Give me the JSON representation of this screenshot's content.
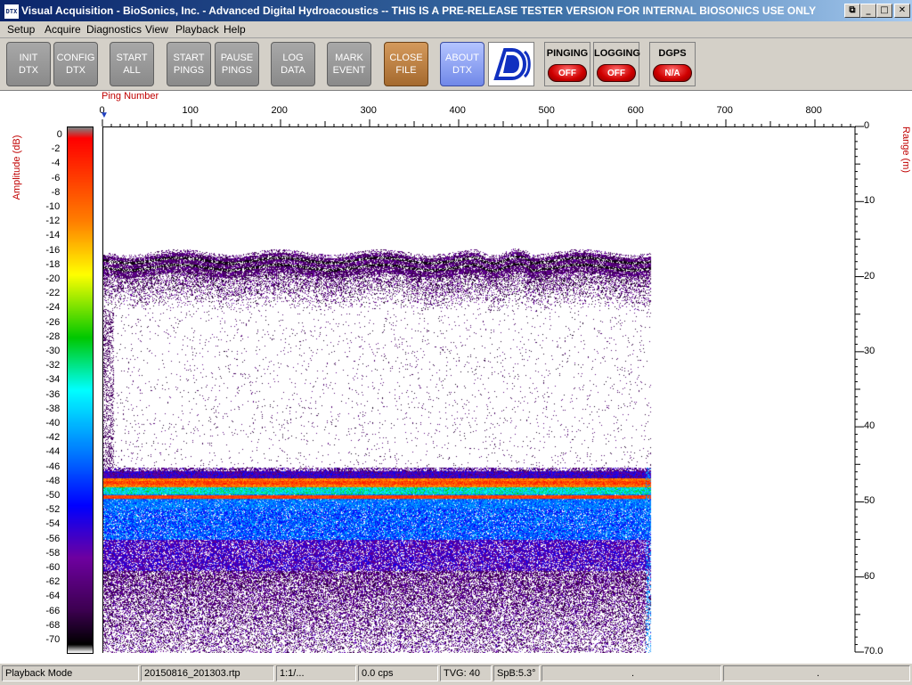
{
  "window": {
    "icon_text": "DTX",
    "title": "Visual Acquisition  -  BioSonics, Inc.  -  Advanced Digital Hydroacoustics  -- THIS IS A PRE-RELEASE TESTER VERSION FOR INTERNAL BIOSONICS USE ONLY",
    "controls": {
      "restore": "⧉",
      "minimize": "_",
      "maximize": "□",
      "close": "✕"
    }
  },
  "menu": [
    "Setup",
    "Acquire",
    "Diagnostics",
    "View",
    "Playback",
    "Help"
  ],
  "toolbar": {
    "buttons": [
      {
        "line1": "INIT",
        "line2": "DTX"
      },
      {
        "line1": "CONFIG",
        "line2": "DTX"
      },
      {
        "line1": "START",
        "line2": "ALL"
      },
      {
        "line1": "START",
        "line2": "PINGS"
      },
      {
        "line1": "PAUSE",
        "line2": "PINGS"
      },
      {
        "line1": "LOG",
        "line2": "DATA"
      },
      {
        "line1": "MARK",
        "line2": "EVENT"
      },
      {
        "line1": "CLOSE",
        "line2": "FILE"
      },
      {
        "line1": "ABOUT",
        "line2": "DTX"
      }
    ],
    "logo_icon": "biosonics-logo-icon",
    "status": [
      {
        "title": "PINGING",
        "value": "OFF"
      },
      {
        "title": "LOGGING",
        "value": "OFF"
      },
      {
        "title": "DGPS",
        "value": "N/A"
      }
    ]
  },
  "echogram": {
    "x_title": "Ping Number",
    "x_ticks": [
      "0",
      "100",
      "200",
      "300",
      "400",
      "500",
      "600",
      "700",
      "800"
    ],
    "amp_title": "Amplitude (dB)",
    "amp_ticks": [
      "0",
      "-2",
      "-4",
      "-6",
      "-8",
      "-10",
      "-12",
      "-14",
      "-16",
      "-18",
      "-20",
      "-22",
      "-24",
      "-26",
      "-28",
      "-30",
      "-32",
      "-34",
      "-36",
      "-38",
      "-40",
      "-42",
      "-44",
      "-46",
      "-48",
      "-50",
      "-52",
      "-54",
      "-56",
      "-58",
      "-60",
      "-62",
      "-64",
      "-66",
      "-68",
      "-70"
    ],
    "range_title": "Range (m)",
    "range_ticks": [
      "0",
      "10",
      "20",
      "30",
      "40",
      "50",
      "60",
      "70.0"
    ],
    "surface_range_m": 17,
    "bottom_range_m": 46,
    "last_ping": 612
  },
  "statusbar": [
    "Playback Mode",
    "20150816_201303.rtp",
    "1:1/...",
    "0.0 cps",
    "TVG: 40",
    "SpB:5.3°",
    ".",
    "."
  ]
}
